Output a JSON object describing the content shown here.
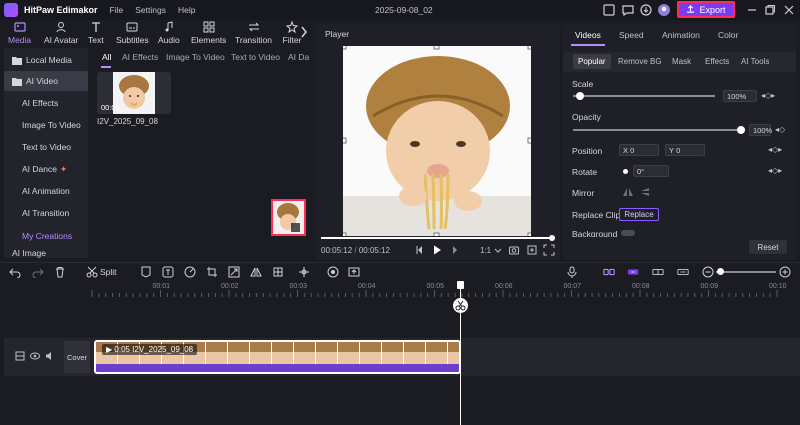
{
  "app": {
    "name": "HitPaw Edimakor",
    "menu": [
      "File",
      "Settings",
      "Help"
    ],
    "doc_title": "2025-09-08_02",
    "export_label": "Export"
  },
  "toolbar": {
    "tabs": [
      {
        "label": "Media",
        "icon": "media-icon"
      },
      {
        "label": "AI Avatar",
        "icon": "avatar-icon"
      },
      {
        "label": "Text",
        "icon": "text-icon"
      },
      {
        "label": "Subtitles",
        "icon": "subtitles-icon"
      },
      {
        "label": "Audio",
        "icon": "audio-icon"
      },
      {
        "label": "Elements",
        "icon": "elements-icon"
      },
      {
        "label": "Transition",
        "icon": "transition-icon"
      },
      {
        "label": "Filter",
        "icon": "filter-icon"
      }
    ]
  },
  "sidebar": {
    "items": [
      {
        "label": "Local Media"
      },
      {
        "label": "AI Video"
      },
      {
        "label": "AI Effects"
      },
      {
        "label": "Image To Video"
      },
      {
        "label": "Text to Video"
      },
      {
        "label": "AI Dance"
      },
      {
        "label": "AI Animation"
      },
      {
        "label": "AI Transition"
      },
      {
        "label": "My Creations"
      },
      {
        "label": "AI Image"
      }
    ]
  },
  "media": {
    "subtabs": [
      "All",
      "AI Effects",
      "Image To Video",
      "Text to Video",
      "AI Da"
    ],
    "item": {
      "duration": "00:05",
      "name": "I2V_2025_09_08"
    }
  },
  "player": {
    "title": "Player",
    "current": "00:05:12",
    "total": "00:05:12",
    "ratio": "1:1"
  },
  "props": {
    "tabs": [
      "Videos",
      "Speed",
      "Animation",
      "Color"
    ],
    "subtabs": [
      "Popular",
      "Remove BG",
      "Mask",
      "Effects",
      "AI Tools"
    ],
    "scale_label": "Scale",
    "scale_value": "100%",
    "scale_level": 0.05,
    "opacity_label": "Opacity",
    "opacity_value": "100%",
    "opacity_level": 1.0,
    "position_label": "Position",
    "pos_x_label": "X",
    "pos_x": "0",
    "pos_y_label": "Y",
    "pos_y": "0",
    "rotate_label": "Rotate",
    "rotate_value": "0°",
    "mirror_label": "Mirror",
    "replace_label": "Replace Clip",
    "replace_button": "Replace",
    "background_label": "Background",
    "reset_label": "Reset"
  },
  "timeline": {
    "split_label": "Split",
    "ticks": [
      "00:01",
      "00:02",
      "00:03",
      "00:04",
      "00:05",
      "00:06",
      "00:07",
      "00:08",
      "00:09",
      "00:10"
    ],
    "cover_label": "Cover",
    "clip_label": "0:05 I2V_2025_09_08"
  },
  "colors": {
    "accent": "#7a3cf0",
    "highlight": "#ff2d55",
    "clip": "#6b3fc9"
  }
}
